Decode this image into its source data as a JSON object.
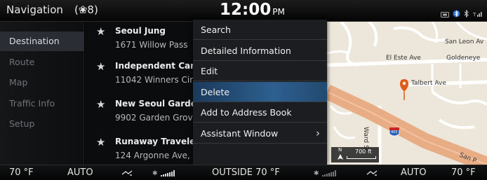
{
  "header": {
    "title": "Navigation",
    "count": "(❀8)",
    "time": "12:00",
    "ampm": "PM"
  },
  "sidebar": {
    "items": [
      {
        "label": "Destination",
        "active": true
      },
      {
        "label": "Route",
        "active": false
      },
      {
        "label": "Map",
        "active": false
      },
      {
        "label": "Traffic Info",
        "active": false
      },
      {
        "label": "Setup",
        "active": false
      }
    ]
  },
  "destinations": [
    {
      "name": "Seoul Jung",
      "address": "1671 Willow Pass"
    },
    {
      "name": "Independent Car S",
      "address": "11042 Winners Cir"
    },
    {
      "name": "New Seoul Garden",
      "address": "9902 Garden Grov"
    },
    {
      "name": "Runaway Traveler",
      "address": "124 Argonne Ave,"
    }
  ],
  "context_menu": {
    "items": [
      {
        "label": "Search"
      },
      {
        "label": "Detailed Information"
      },
      {
        "label": "Edit"
      },
      {
        "label": "Delete",
        "selected": true
      },
      {
        "label": "Add to Address Book"
      },
      {
        "label": "Assistant Window",
        "submenu": true
      }
    ],
    "selected_color": "#2d5f8f"
  },
  "map": {
    "streets": [
      "San Leon Av",
      "El Este Ave",
      "Goldeneye",
      "Talbert Ave",
      "Ward St",
      "San P"
    ],
    "highway_shield": "405",
    "scale": "700 ft",
    "north_label": "N",
    "pin_color": "#e05a1a",
    "highway_color": "#e9ad86"
  },
  "climate": {
    "left_temp": "70 °F",
    "left_mode": "AUTO",
    "outside": "OUTSIDE  70 °F",
    "right_mode": "AUTO",
    "right_temp": "70 °F"
  }
}
